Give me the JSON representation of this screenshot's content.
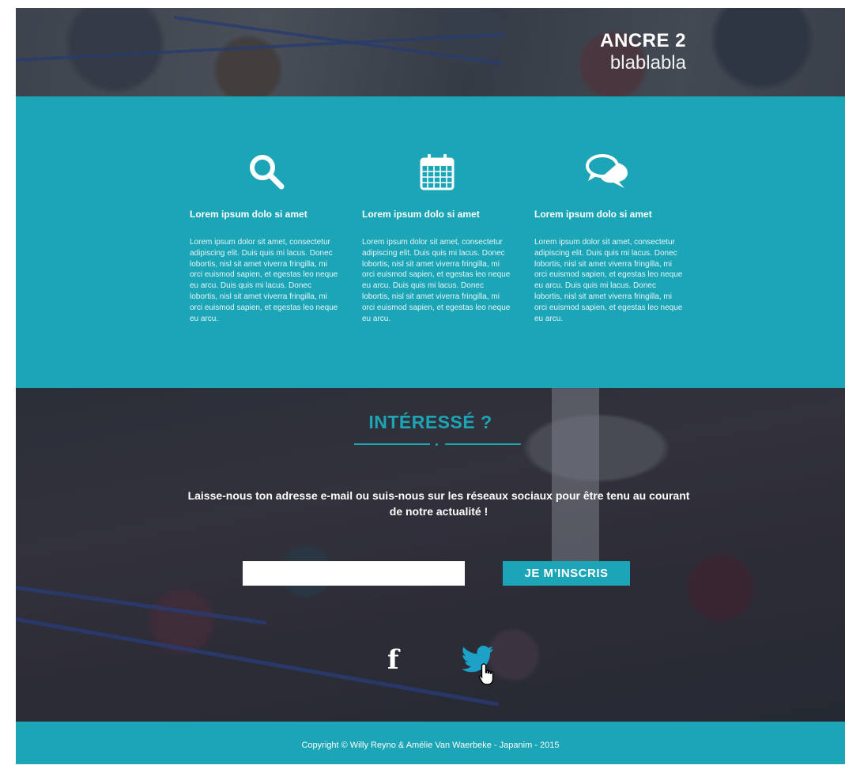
{
  "hero": {
    "title": "ANCRE 2",
    "subtitle": "blablabla"
  },
  "features": [
    {
      "icon": "search-icon",
      "title": "Lorem ipsum dolo si amet",
      "text": "Lorem ipsum dolor sit amet, consectetur adipiscing elit. Duis quis mi lacus. Donec lobortis, nisl sit amet viverra fringilla, mi orci euismod sapien, et egestas leo neque eu arcu. Duis quis mi lacus. Donec lobortis, nisl sit amet viverra fringilla, mi orci euismod sapien, et egestas leo neque eu arcu."
    },
    {
      "icon": "calendar-icon",
      "title": "Lorem ipsum dolo si amet",
      "text": "Lorem ipsum dolor sit amet, consectetur adipiscing elit. Duis quis mi lacus. Donec lobortis, nisl sit amet viverra fringilla, mi orci euismod sapien, et egestas leo neque eu arcu. Duis quis mi lacus. Donec lobortis, nisl sit amet viverra fringilla, mi orci euismod sapien, et egestas leo neque eu arcu."
    },
    {
      "icon": "chat-bubbles-icon",
      "title": "Lorem ipsum dolo si amet",
      "text": "Lorem ipsum dolor sit amet, consectetur adipiscing elit. Duis quis mi lacus. Donec lobortis, nisl sit amet viverra fringilla, mi orci euismod sapien, et egestas leo neque eu arcu. Duis quis mi lacus. Donec lobortis, nisl sit amet viverra fringilla, mi orci euismod sapien, et egestas leo neque eu arcu."
    }
  ],
  "cta": {
    "title": "INTÉRESSÉ ?",
    "text": "Laisse-nous ton adresse e-mail ou suis-nous sur les réseaux sociaux pour être tenu au courant de notre actualité !",
    "email_value": "",
    "button_label": "JE M’INSCRIS",
    "social": [
      "facebook-icon",
      "twitter-icon"
    ]
  },
  "footer": {
    "copyright": "Copyright © Willy Reyno & Amélie Van Waerbeke  -  Japanim - 2015"
  },
  "colors": {
    "accent": "#1ba5b7",
    "text_light": "#ffffff"
  }
}
